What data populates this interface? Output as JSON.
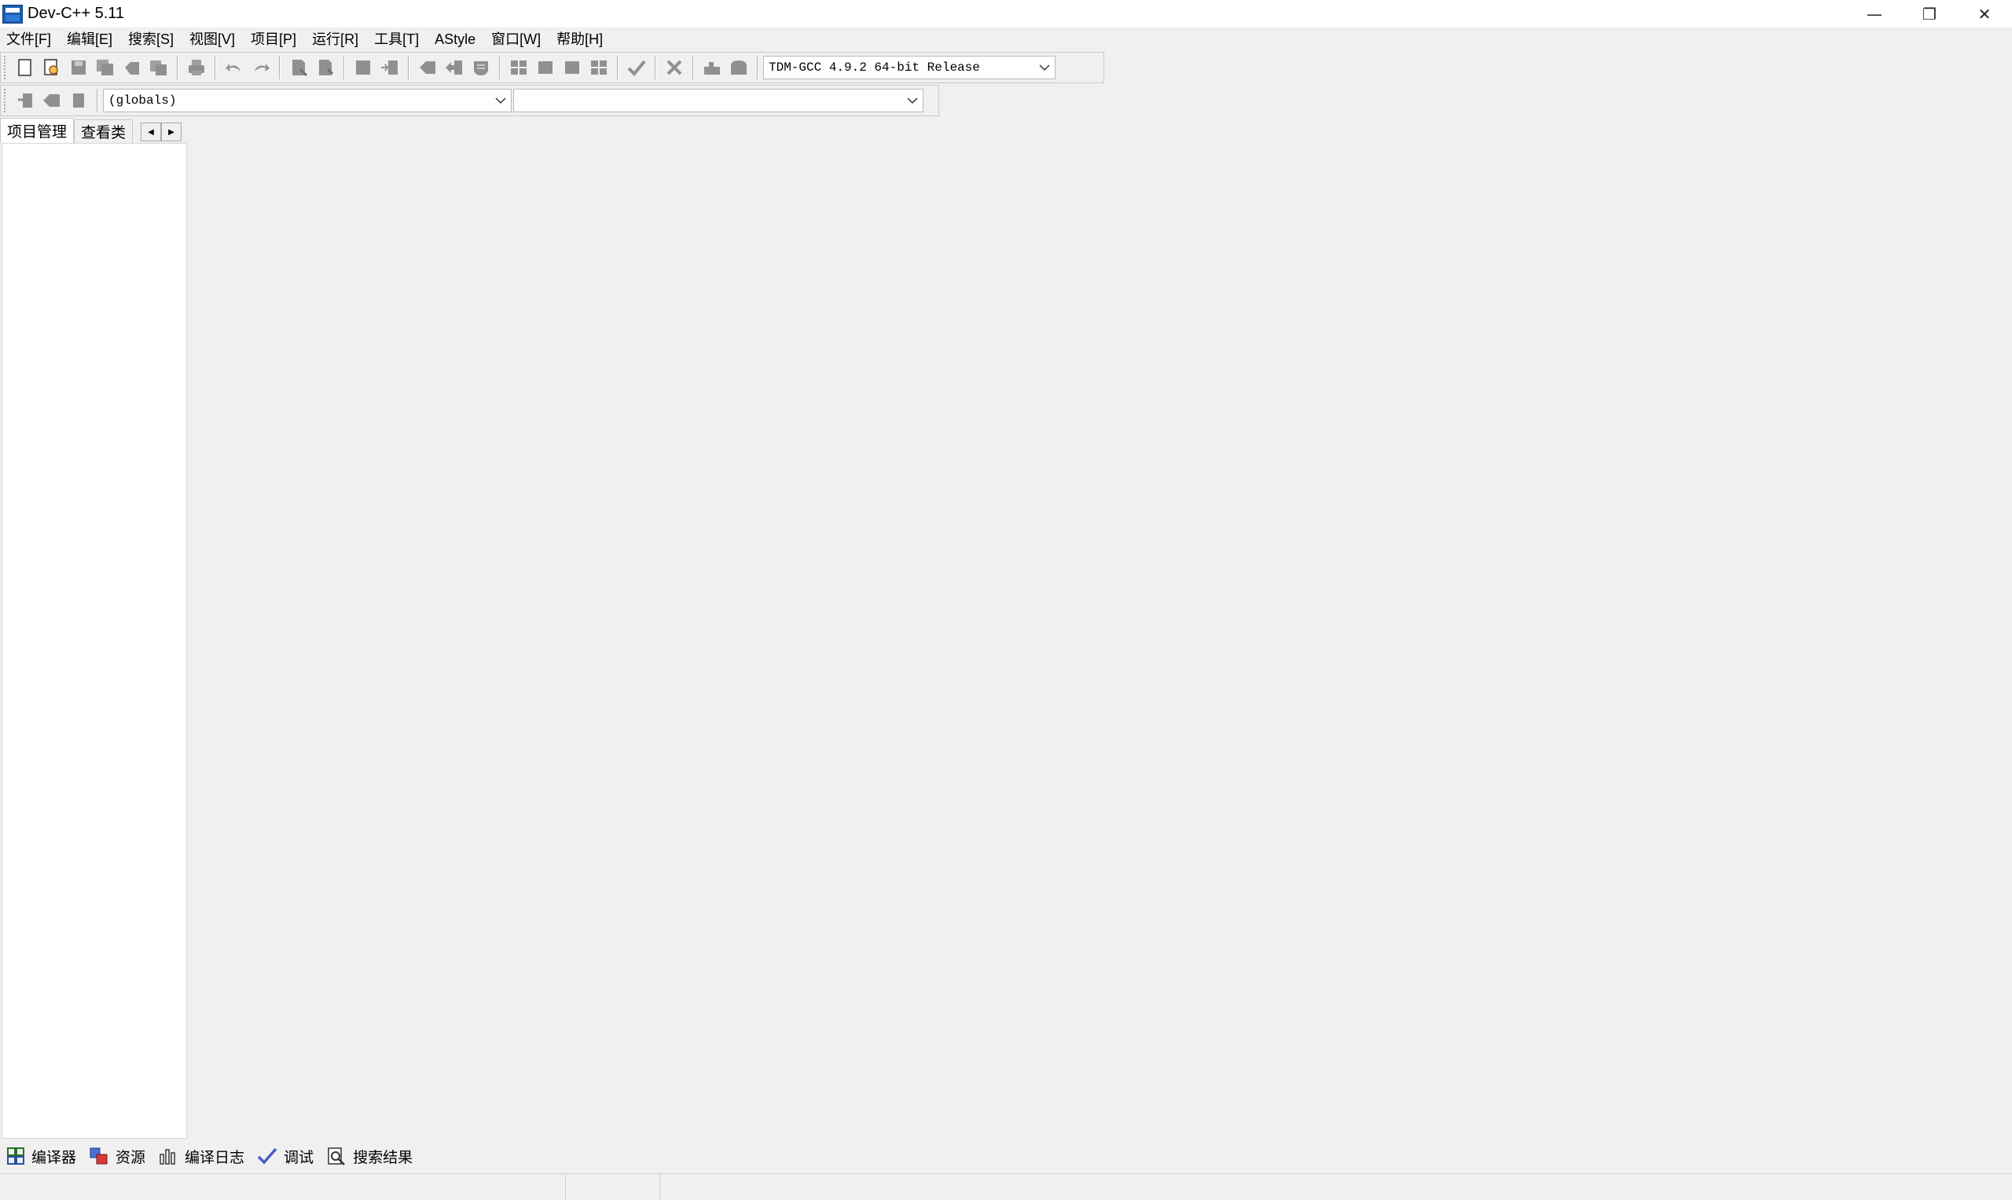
{
  "window": {
    "title": "Dev-C++ 5.11",
    "controls": {
      "minimize": "—",
      "restore": "❐",
      "close": "✕"
    }
  },
  "menu": {
    "items": [
      "文件[F]",
      "编辑[E]",
      "搜索[S]",
      "视图[V]",
      "项目[P]",
      "运行[R]",
      "工具[T]",
      "AStyle",
      "窗口[W]",
      "帮助[H]"
    ]
  },
  "toolbar": {
    "compiler_select": "TDM-GCC 4.9.2 64-bit Release",
    "scope_select": "(globals)",
    "member_select": ""
  },
  "left_panel": {
    "tabs": [
      "项目管理",
      "查看类"
    ],
    "active_tab": 0,
    "scroll_left": "◀",
    "scroll_right": "▶"
  },
  "bottom_tabs": {
    "items": [
      "编译器",
      "资源",
      "编译日志",
      "调试",
      "搜索结果"
    ]
  },
  "colors": {
    "background": "#f0f0f0",
    "pane": "#ffffff",
    "icon_gray": "#909090",
    "check_blue": "#4a5bc4"
  }
}
